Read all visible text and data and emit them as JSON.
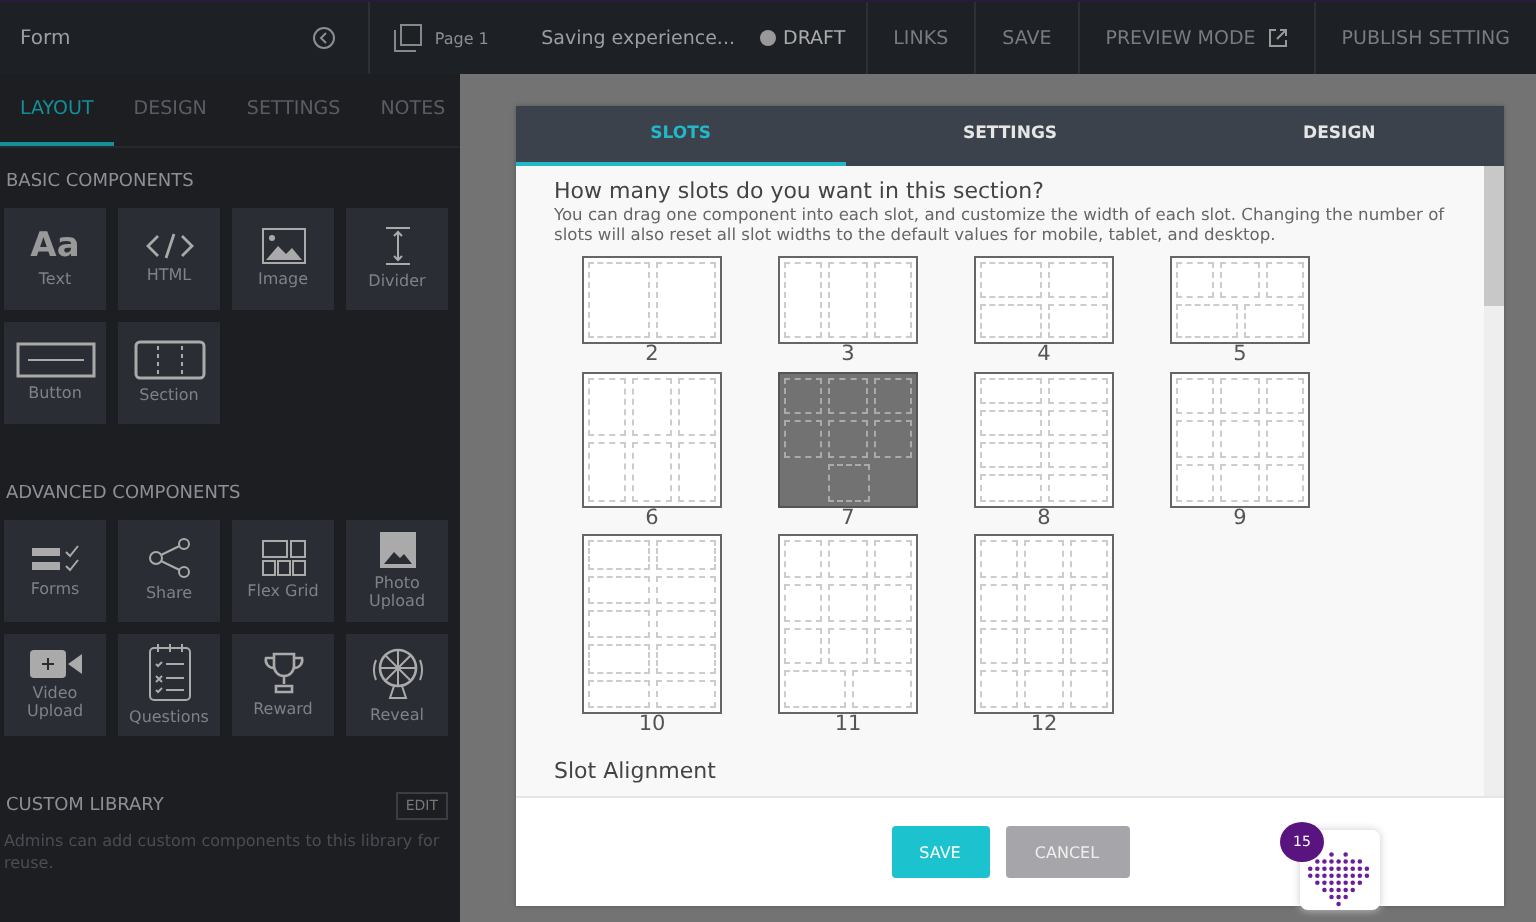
{
  "topbar": {
    "title": "Form",
    "page": "Page 1",
    "status": "Saving experience...",
    "draft": "DRAFT",
    "actions": [
      {
        "label": "LINKS",
        "kind": "plain"
      },
      {
        "label": "SAVE",
        "kind": "plain"
      },
      {
        "label": "PREVIEW MODE",
        "kind": "external"
      },
      {
        "label": "PUBLISH SETTING",
        "kind": "plain"
      }
    ]
  },
  "sidebar": {
    "tabs": [
      {
        "label": "LAYOUT",
        "selected": true
      },
      {
        "label": "DESIGN",
        "selected": false
      },
      {
        "label": "SETTINGS",
        "selected": false
      },
      {
        "label": "NOTES",
        "selected": false
      }
    ],
    "groups": [
      {
        "title": "BASIC COMPONENTS",
        "items": [
          {
            "label": "Text",
            "kind": "text",
            "glyph": "Aa"
          },
          {
            "label": "HTML",
            "kind": "html"
          },
          {
            "label": "Image",
            "kind": "image"
          },
          {
            "label": "Divider",
            "kind": "divider"
          },
          {
            "label": "Button",
            "kind": "button"
          },
          {
            "label": "Section",
            "kind": "section"
          }
        ]
      },
      {
        "title": "ADVANCED COMPONENTS",
        "items": [
          {
            "label": "Forms",
            "kind": "forms"
          },
          {
            "label": "Share",
            "kind": "share"
          },
          {
            "label": "Flex Grid",
            "kind": "grid"
          },
          {
            "label": "Photo Upload",
            "kind": "photo"
          },
          {
            "label": "Video Upload",
            "kind": "video"
          },
          {
            "label": "Questions",
            "kind": "questions"
          },
          {
            "label": "Reward",
            "kind": "trophy"
          },
          {
            "label": "Reveal",
            "kind": "wheel"
          }
        ]
      }
    ],
    "library": {
      "title": "CUSTOM LIBRARY",
      "edit": "EDIT",
      "text": "Admins can add custom components to this library for reuse."
    }
  },
  "modal": {
    "tabs": [
      {
        "label": "SLOTS",
        "selected": true
      },
      {
        "label": "SETTINGS",
        "selected": false
      },
      {
        "label": "DESIGN",
        "selected": false
      }
    ],
    "heading": "How many slots do you want in this section?",
    "description": "You can drag one component into each slot, and customize the width of each slot. Changing the number of slots will also reset all slot widths to the default values for mobile, tablet, and desktop.",
    "slots": [
      {
        "label": "2",
        "kind": "two",
        "selected": false
      },
      {
        "label": "3",
        "kind": "three",
        "selected": false
      },
      {
        "label": "4",
        "kind": "four",
        "selected": false
      },
      {
        "label": "5",
        "kind": "five",
        "selected": false
      },
      {
        "label": "6",
        "kind": "six",
        "selected": false
      },
      {
        "label": "7",
        "kind": "seven",
        "selected": true
      },
      {
        "label": "8",
        "kind": "eight",
        "selected": false
      },
      {
        "label": "9",
        "kind": "nine",
        "selected": false
      },
      {
        "label": "10",
        "kind": "ten",
        "selected": false
      },
      {
        "label": "11",
        "kind": "eleven",
        "selected": false
      },
      {
        "label": "12",
        "kind": "twelve",
        "selected": false
      }
    ],
    "alignment_heading": "Slot Alignment",
    "save": "SAVE",
    "cancel": "CANCEL"
  },
  "widget": {
    "badge": "15"
  }
}
